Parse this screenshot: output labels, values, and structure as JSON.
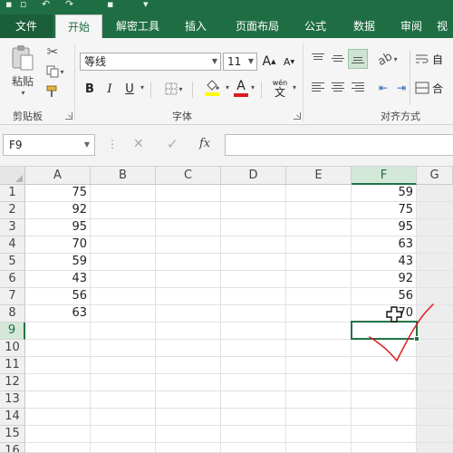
{
  "ribbon_tabs": [
    "文件",
    "开始",
    "解密工具",
    "插入",
    "页面布局",
    "公式",
    "数据",
    "审阅",
    "视"
  ],
  "ribbon": {
    "clipboard": {
      "paste_label": "粘贴",
      "group_label": "剪贴板"
    },
    "font": {
      "font_name": "等线",
      "font_size": "11",
      "grow_label": "A",
      "shrink_label": "A",
      "bold_label": "B",
      "italic_label": "I",
      "underline_label": "U",
      "phonetic_top": "wén",
      "phonetic_bottom": "文",
      "group_label": "字体"
    },
    "alignment": {
      "group_label": "对齐方式",
      "wrap_label": "自",
      "merge_label": "合"
    }
  },
  "formula_bar": {
    "name_box": "F9",
    "cancel_label": "✕",
    "enter_label": "✓",
    "fx_label": "fx",
    "formula": ""
  },
  "sheet": {
    "columns": [
      "A",
      "B",
      "C",
      "D",
      "E",
      "F",
      "G"
    ],
    "rows": [
      "1",
      "2",
      "3",
      "4",
      "5",
      "6",
      "7",
      "8",
      "9",
      "10",
      "11",
      "12",
      "13",
      "14",
      "15",
      "16"
    ],
    "col_a": [
      "75",
      "92",
      "95",
      "70",
      "59",
      "43",
      "56",
      "63"
    ],
    "col_f": [
      "59",
      "75",
      "95",
      "63",
      "43",
      "92",
      "56",
      "70"
    ],
    "selected_cell": "F9"
  },
  "colors": {
    "brand": "#217346",
    "title_bg": "#1f6e43",
    "annotation": "#e0191c"
  }
}
